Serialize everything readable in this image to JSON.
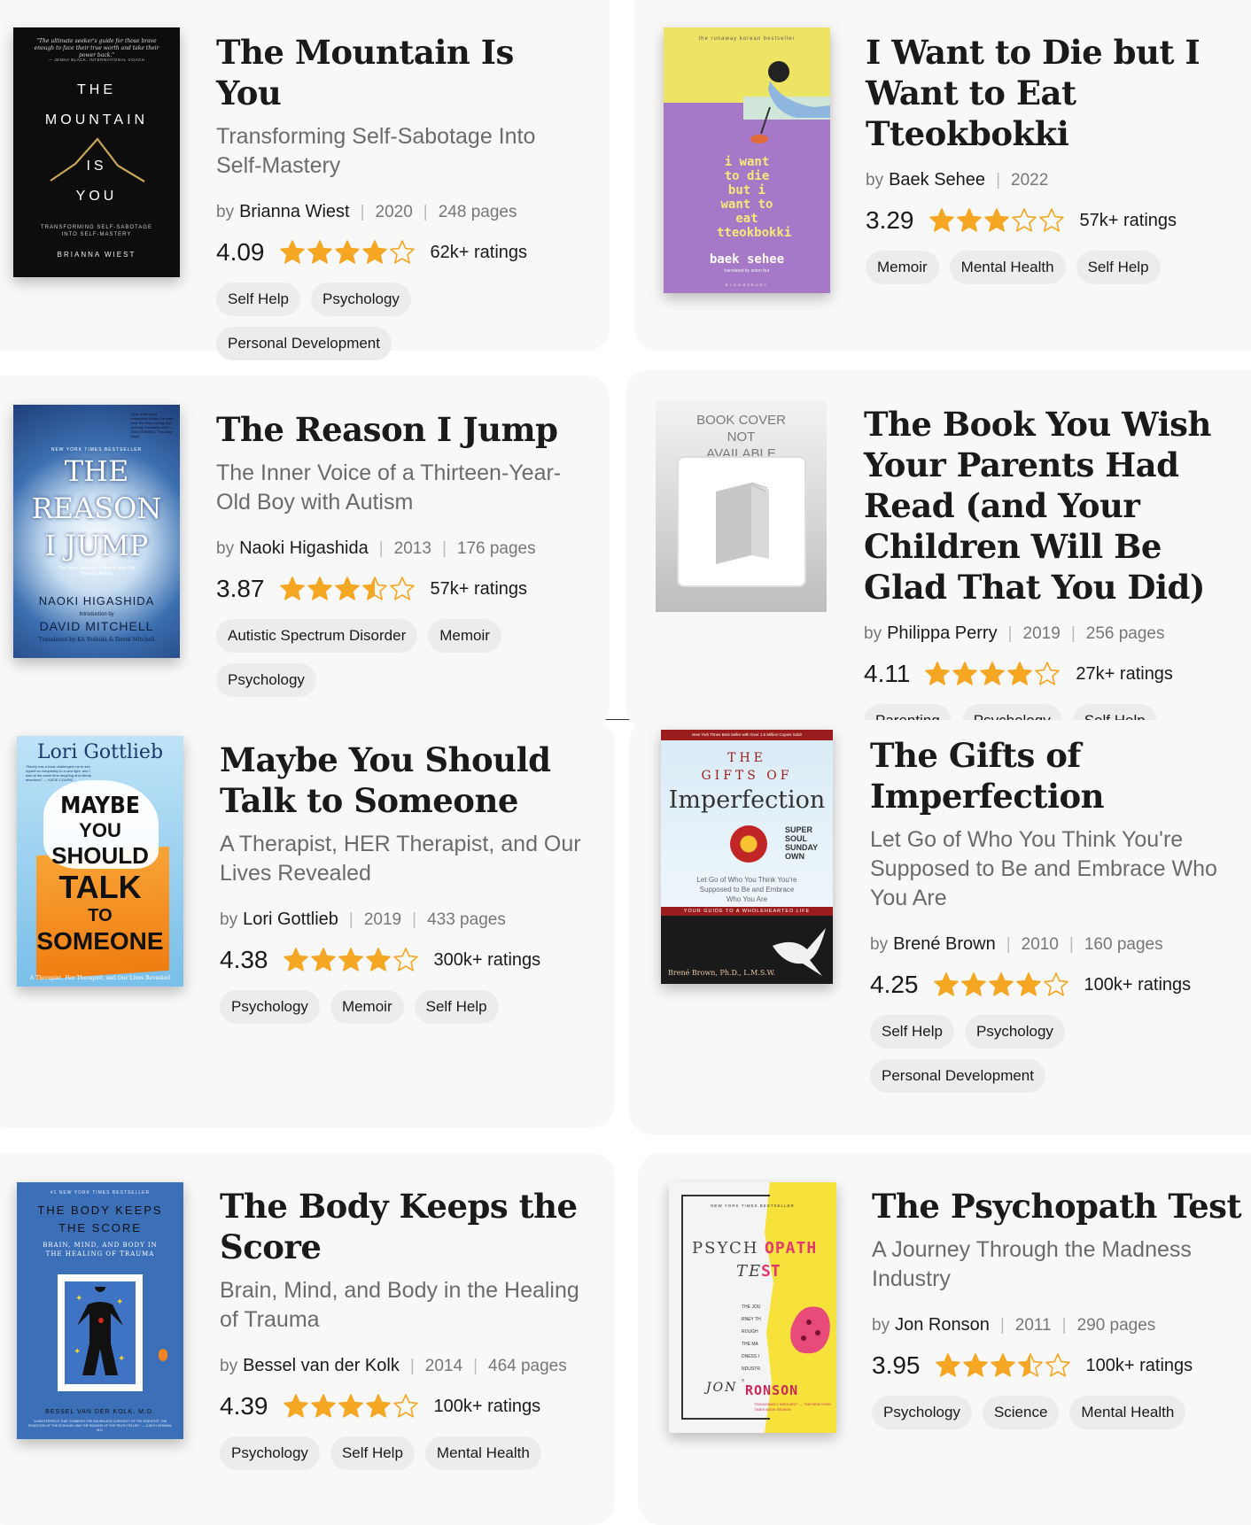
{
  "colors": {
    "star": "#f5a623",
    "tag_bg": "#ececec",
    "card_bg": "#f8f8f8"
  },
  "books": [
    {
      "title": "The Mountain Is You",
      "subtitle": "Transforming Self-Sabotage Into Self-Mastery",
      "by": "by",
      "author": "Brianna Wiest",
      "year": "2020",
      "pages": "248 pages",
      "rating": "4.09",
      "stars": 4,
      "ratings": "62k+ ratings",
      "tags": [
        "Self Help",
        "Psychology",
        "Personal Development"
      ],
      "cover": {
        "quote": "\"The ultimate seeker's guide for those brave enough to face their true worth and take their power back.\"",
        "quote_by": "— JENNA BLACK, INTERNATIONAL COACH",
        "line1": "THE",
        "line2": "MOUNTAIN",
        "line3": "IS",
        "line4": "YOU",
        "tagline": "TRANSFORMING SELF-SABOTAGE INTO SELF-MASTERY",
        "author": "BRIANNA WIEST"
      }
    },
    {
      "title": "I Want to Die but I Want to Eat Tteokbokki",
      "subtitle": "",
      "by": "by",
      "author": "Baek Sehee",
      "year": "2022",
      "pages": "",
      "rating": "3.29",
      "stars": 3,
      "ratings": "57k+ ratings",
      "tags": [
        "Memoir",
        "Mental Health",
        "Self Help"
      ],
      "cover": {
        "top": "the runaway korean bestseller",
        "title": "i want to die but i want to eat tteokbokki",
        "author": "baek sehee",
        "translator": "translated by anton hur",
        "publisher": "BLOOMSBURY"
      }
    },
    {
      "title": "The Reason I Jump",
      "subtitle": "The Inner Voice of a Thirteen-Year-Old Boy with Autism",
      "by": "by",
      "author": "Naoki Higashida",
      "year": "2013",
      "pages": "176 pages",
      "rating": "3.87",
      "stars": 3.5,
      "ratings": "57k+ ratings",
      "tags": [
        "Autistic Spectrum Disorder",
        "Memoir",
        "Psychology"
      ],
      "cover": {
        "quote": "\"One of the most remarkable books I've ever read. It's truly moving, eye-opening, incredibly vivid\" — JON STEWART, The Daily Show",
        "bestseller": "NEW YORK TIMES BESTSELLER",
        "line1": "THE",
        "line2": "REASON",
        "line3": "I JUMP",
        "tagline": "The Inner Voice of a Thirteen-Year-Old Boy with Autism",
        "author": "NAOKI HIGASHIDA",
        "intro": "Introduction by",
        "intro_author": "DAVID MITCHELL",
        "translated": "Translated by KA Yoshida & David Mitchell"
      }
    },
    {
      "title": "The Book You Wish Your Parents Had Read (and Your Children Will Be Glad That You Did)",
      "subtitle": "",
      "by": "by",
      "author": "Philippa Perry",
      "year": "2019",
      "pages": "256 pages",
      "rating": "4.11",
      "stars": 4,
      "ratings": "27k+ ratings",
      "tags": [
        "Parenting",
        "Psychology",
        "Self Help"
      ],
      "cover": {
        "placeholder": "BOOK COVER NOT AVAILABLE"
      }
    },
    {
      "title": "Maybe You Should Talk to Someone",
      "subtitle": "A Therapist, HER Therapist, and Our Lives Revealed",
      "by": "by",
      "author": "Lori Gottlieb",
      "year": "2019",
      "pages": "433 pages",
      "rating": "4.38",
      "stars": 4,
      "ratings": "300k+ ratings",
      "tags": [
        "Psychology",
        "Memoir",
        "Self Help"
      ],
      "cover": {
        "author": "Lori Gottlieb",
        "quote": "\"Rarely has a book challenged me to see myself so completely in a new light, and I was at the same time laughing and utterly absorbed.\" — KATIE COURIC",
        "line1": "MAYBE",
        "line2": "YOU",
        "line3": "SHOULD",
        "line4": "TALK",
        "line5": "TO",
        "line6": "SOMEONE",
        "tagline": "A Therapist, Her Therapist, and Our Lives Revealed"
      }
    },
    {
      "title": "The Gifts of Imperfection",
      "subtitle": "Let Go of Who You Think You're Supposed to Be and Embrace Who You Are",
      "by": "by",
      "author": "Brené Brown",
      "year": "2010",
      "pages": "160 pages",
      "rating": "4.25",
      "stars": 4,
      "ratings": "100k+ ratings",
      "tags": [
        "Self Help",
        "Psychology",
        "Personal Development"
      ],
      "cover": {
        "top": "New York Times Best Seller with Over 1.5 Million Copies Sold!",
        "line1": "THE",
        "line2": "GIFTS OF",
        "line3": "Imperfection",
        "badge": "SUPER SOUL SUNDAY OWN",
        "desc": "Let Go of Who You Think You're Supposed to Be and Embrace Who You Are",
        "band": "YOUR GUIDE TO A WHOLEHEARTED LIFE",
        "author": "Brené Brown, Ph.D., L.M.S.W."
      }
    },
    {
      "title": "The Body Keeps the Score",
      "subtitle": "Brain, Mind, and Body in the Healing of Trauma",
      "by": "by",
      "author": "Bessel van der Kolk",
      "year": "2014",
      "pages": "464 pages",
      "rating": "4.39",
      "stars": 4,
      "ratings": "100k+ ratings",
      "tags": [
        "Psychology",
        "Self Help",
        "Mental Health"
      ],
      "cover": {
        "bestseller": "#1 NEW YORK TIMES BESTSELLER",
        "line1": "THE BODY KEEPS",
        "line2": "THE SCORE",
        "tagline": "BRAIN, MIND, AND BODY IN THE HEALING OF TRAUMA",
        "author": "BESSEL VAN DER KOLK, M.D.",
        "blurb": "\"A MASTERPIECE THAT COMBINES THE BOUNDLESS CURIOSITY OF THE SCIENTIST, THE ERUDITION OF THE SCHOLAR, AND THE PASSION OF THE TRUTH TELLER.\" — JUDITH HERMAN, M.D."
      }
    },
    {
      "title": "The Psychopath Test",
      "subtitle": "A Journey Through the Madness Industry",
      "by": "by",
      "author": "Jon Ronson",
      "year": "2011",
      "pages": "290 pages",
      "rating": "3.95",
      "stars": 3.5,
      "ratings": "100k+ ratings",
      "tags": [
        "Psychology",
        "Science",
        "Mental Health"
      ],
      "cover": {
        "top": "NEW YORK TIMES BESTSELLER",
        "line1a": "PSYCH",
        "line1b": "OPATH",
        "line2a": "TE",
        "line2b": "ST",
        "middle": "THE JOURNEY THROUGH THE MADNESS INDUSTRY",
        "author_a": "JON",
        "author_b": "RONSON",
        "quote": "\"ENGAGINGLY INSOLENT\" — THE NEW YORK TIMES BOOK REVIEW"
      }
    }
  ]
}
